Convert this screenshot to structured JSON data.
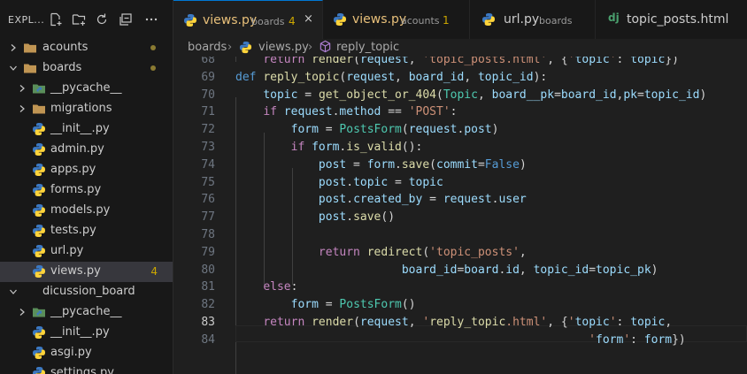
{
  "explorer": {
    "title": "EXPL...",
    "actions": [
      "new-file-icon",
      "new-folder-icon",
      "refresh-icon",
      "collapse-all-icon",
      "more-icon"
    ],
    "tree": [
      {
        "label": "acounts",
        "type": "folder",
        "state": "collapsed",
        "dot": true
      },
      {
        "label": "boards",
        "type": "folder",
        "state": "expanded",
        "dot": true
      },
      {
        "label": "__pycache__",
        "type": "pycache",
        "state": "collapsed"
      },
      {
        "label": "migrations",
        "type": "folder",
        "state": "collapsed"
      },
      {
        "label": "__init__.py",
        "type": "python"
      },
      {
        "label": "admin.py",
        "type": "python"
      },
      {
        "label": "apps.py",
        "type": "python"
      },
      {
        "label": "forms.py",
        "type": "python"
      },
      {
        "label": "models.py",
        "type": "python"
      },
      {
        "label": "tests.py",
        "type": "python"
      },
      {
        "label": "url.py",
        "type": "python"
      },
      {
        "label": "views.py",
        "type": "python",
        "badge": "4",
        "selected": true
      },
      {
        "label": "dicussion_board",
        "type": "none",
        "state": "expanded"
      },
      {
        "label": "__pycache__",
        "type": "pycache",
        "state": "collapsed"
      },
      {
        "label": "__init__.py",
        "type": "python"
      },
      {
        "label": "asgi.py",
        "type": "python"
      },
      {
        "label": "settings.py",
        "type": "python"
      }
    ]
  },
  "tabs": [
    {
      "name": "views.py",
      "desc": "boards",
      "num": "4",
      "close": "×",
      "active": true
    },
    {
      "name": "views.py",
      "desc": "acounts",
      "num": "1"
    },
    {
      "name": "url.py",
      "desc": "boards"
    },
    {
      "name": "topic_posts.html",
      "desc": ""
    }
  ],
  "breadcrumb": [
    "boards",
    "views.py",
    "reply_topic"
  ],
  "editor": {
    "current_line": 83,
    "lines": [
      {
        "n": 68,
        "text": "    return render(request, 'topic_posts.html', {'topic': topic})"
      },
      {
        "n": 69,
        "text": "def reply_topic(request, board_id, topic_id):"
      },
      {
        "n": 70,
        "text": "    topic = get_object_or_404(Topic, board__pk=board_id,pk=topic_id)"
      },
      {
        "n": 71,
        "text": "    if request.method == 'POST':"
      },
      {
        "n": 72,
        "text": "        form = PostsForm(request.post)"
      },
      {
        "n": 73,
        "text": "        if form.is_valid():"
      },
      {
        "n": 74,
        "text": "            post = form.save(commit=False)"
      },
      {
        "n": 75,
        "text": "            post.topic = topic"
      },
      {
        "n": 76,
        "text": "            post.created_by = request.user"
      },
      {
        "n": 77,
        "text": "            post.save()"
      },
      {
        "n": 78,
        "text": ""
      },
      {
        "n": 79,
        "text": "            return redirect('topic_posts',"
      },
      {
        "n": 80,
        "text": "                        board_id=board.id, topic_id=topic_pk)"
      },
      {
        "n": 81,
        "text": "    else:"
      },
      {
        "n": 82,
        "text": "        form = PostsForm()"
      },
      {
        "n": 83,
        "text": "    return render(request, 'reply_topic.html', {'topic': topic,"
      },
      {
        "n": 84,
        "text": "                                                   'form': form})"
      }
    ]
  },
  "colors": {
    "python_icon_blue": "#3572a5",
    "python_icon_yellow": "#ffd43b",
    "folder": "#c09553",
    "badge": "#cca700"
  }
}
